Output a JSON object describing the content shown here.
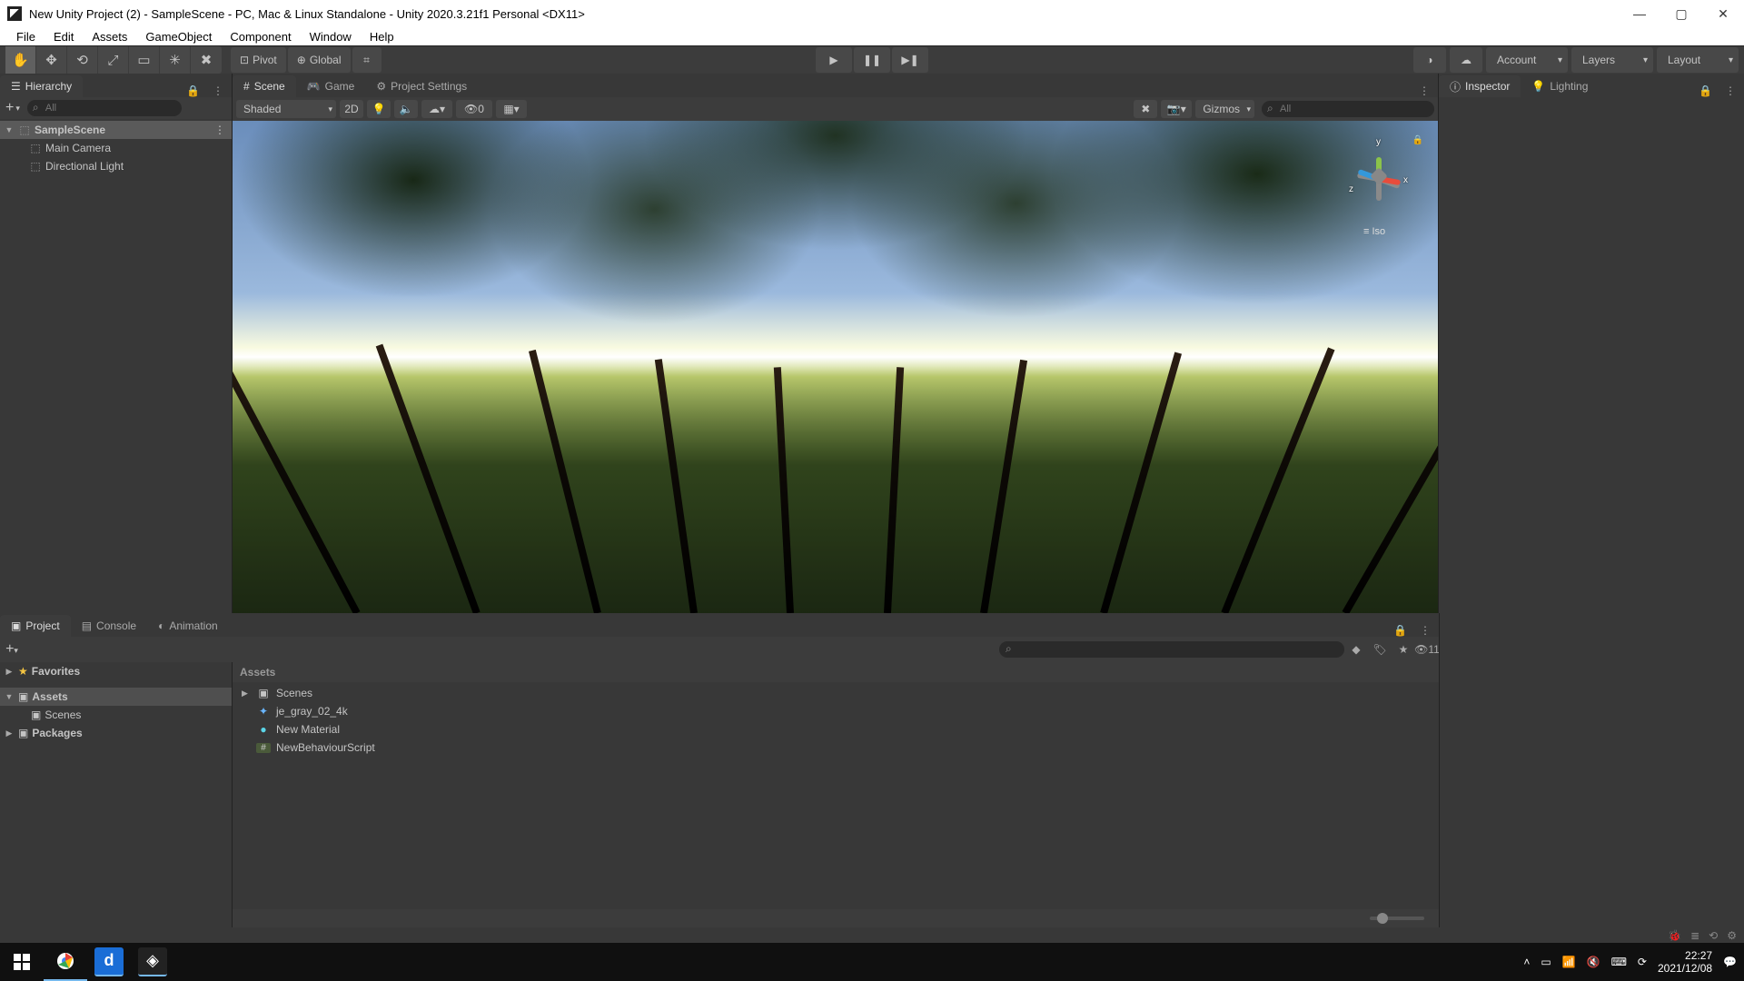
{
  "window": {
    "title": "New Unity Project (2) - SampleScene - PC, Mac & Linux Standalone - Unity 2020.3.21f1 Personal <DX11>"
  },
  "menubar": [
    "File",
    "Edit",
    "Assets",
    "GameObject",
    "Component",
    "Window",
    "Help"
  ],
  "toolbar": {
    "pivot": "Pivot",
    "global": "Global",
    "account": "Account",
    "layers": "Layers",
    "layout": "Layout"
  },
  "hierarchy": {
    "tab": "Hierarchy",
    "search_placeholder": "All",
    "scene": "SampleScene",
    "items": [
      "Main Camera",
      "Directional Light"
    ]
  },
  "center_tabs": {
    "scene": "Scene",
    "game": "Game",
    "settings": "Project Settings"
  },
  "scene_toolbar": {
    "shading": "Shaded",
    "two_d": "2D",
    "hidden_count": "0",
    "gizmos": "Gizmos",
    "search_placeholder": "All"
  },
  "gizmo": {
    "x": "x",
    "y": "y",
    "z": "z",
    "iso": "Iso"
  },
  "inspector": {
    "inspector": "Inspector",
    "lighting": "Lighting"
  },
  "project": {
    "tabs": {
      "project": "Project",
      "console": "Console",
      "animation": "Animation"
    },
    "favorites": "Favorites",
    "assets": "Assets",
    "scenes": "Scenes",
    "packages": "Packages",
    "crumb": "Assets",
    "items": [
      {
        "icon": "folder",
        "name": "Scenes"
      },
      {
        "icon": "hdr",
        "name": "je_gray_02_4k"
      },
      {
        "icon": "mat",
        "name": "New Material"
      },
      {
        "icon": "cs",
        "name": "NewBehaviourScript"
      }
    ],
    "hidden_count": "11"
  },
  "taskbar": {
    "time": "22:27",
    "date": "2021/12/08"
  }
}
